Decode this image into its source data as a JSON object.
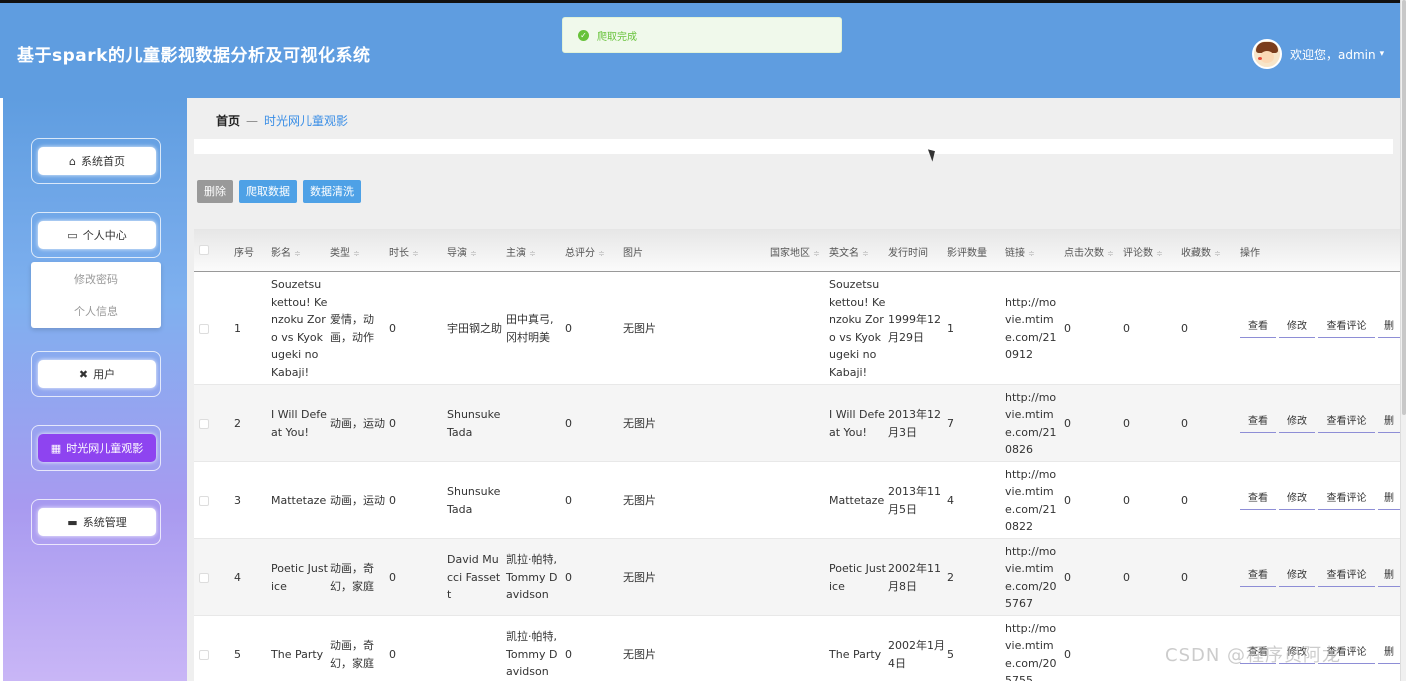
{
  "app": {
    "title": "基于spark的儿童影视数据分析及可视化系统"
  },
  "user": {
    "welcome": "欢迎您，admin",
    "caret": "▾"
  },
  "toast": {
    "message": "爬取完成",
    "icon": "✓"
  },
  "sidebar": {
    "items": [
      {
        "label": "系统首页",
        "icon": "⌂"
      },
      {
        "label": "个人中心",
        "icon": "▭"
      },
      {
        "label": "用户",
        "icon": "✖"
      },
      {
        "label": "时光网儿童观影",
        "icon": "▦"
      },
      {
        "label": "系统管理",
        "icon": "▬"
      }
    ],
    "submenu": [
      "修改密码",
      "个人信息"
    ]
  },
  "breadcrumb": {
    "home": "首页",
    "sep": "—",
    "current": "时光网儿童观影"
  },
  "toolbar": {
    "delete": "删除",
    "crawl": "爬取数据",
    "clean": "数据清洗"
  },
  "table": {
    "headers": {
      "index": "序号",
      "name": "影名",
      "type": "类型",
      "duration": "时长",
      "director": "导演",
      "actors": "主演",
      "score": "总评分",
      "picture": "图片",
      "region": "国家地区",
      "en_name": "英文名",
      "release": "发行时间",
      "rating_count": "影评数量",
      "link": "链接",
      "clicks": "点击次数",
      "comments": "评论数",
      "favorites": "收藏数",
      "ops": "操作"
    },
    "sort_glyph": "≑",
    "actions": {
      "view": "查看",
      "edit": "修改",
      "view_comments": "查看评论",
      "delete": "删"
    },
    "rows": [
      {
        "index": "1",
        "name": "Souzetsu kettou! Kenzoku Zoro vs Kyokugeki no Kabaji!",
        "type": "爱情，动画，动作",
        "duration": "0",
        "director": "宇田钢之助",
        "actors": "田中真弓,冈村明美",
        "score": "0",
        "picture": "无图片",
        "region": "",
        "en_name": "Souzetsu kettou! Kenzoku Zoro vs Kyokugeki no Kabaji!",
        "release": "1999年12月29日",
        "rating_count": "1",
        "link": "http://movie.mtime.com/210912",
        "clicks": "0",
        "comments": "0",
        "favorites": "0"
      },
      {
        "index": "2",
        "name": "I Will Defeat You!",
        "type": "动画，运动",
        "duration": "0",
        "director": "Shunsuke Tada",
        "actors": "",
        "score": "0",
        "picture": "无图片",
        "region": "",
        "en_name": "I Will Defeat You!",
        "release": "2013年12月3日",
        "rating_count": "7",
        "link": "http://movie.mtime.com/210826",
        "clicks": "0",
        "comments": "0",
        "favorites": "0"
      },
      {
        "index": "3",
        "name": "Mattetaze",
        "type": "动画，运动",
        "duration": "0",
        "director": "Shunsuke Tada",
        "actors": "",
        "score": "0",
        "picture": "无图片",
        "region": "",
        "en_name": "Mattetaze",
        "release": "2013年11月5日",
        "rating_count": "4",
        "link": "http://movie.mtime.com/210822",
        "clicks": "0",
        "comments": "0",
        "favorites": "0"
      },
      {
        "index": "4",
        "name": "Poetic Justice",
        "type": "动画，奇幻，家庭",
        "duration": "0",
        "director": "David Mucci Fassett",
        "actors": "凯拉·帕特,Tommy Davidson",
        "score": "0",
        "picture": "无图片",
        "region": "",
        "en_name": "Poetic Justice",
        "release": "2002年11月8日",
        "rating_count": "2",
        "link": "http://movie.mtime.com/205767",
        "clicks": "0",
        "comments": "0",
        "favorites": "0"
      },
      {
        "index": "5",
        "name": "The Party",
        "type": "动画，奇幻，家庭",
        "duration": "0",
        "director": "",
        "actors": "凯拉·帕特,Tommy Davidson",
        "score": "0",
        "picture": "无图片",
        "region": "",
        "en_name": "The Party",
        "release": "2002年1月4日",
        "rating_count": "5",
        "link": "http://movie.mtime.com/205755",
        "clicks": "0",
        "comments": "",
        "favorites": ""
      }
    ]
  },
  "watermark": "CSDN @程序员阿龙"
}
